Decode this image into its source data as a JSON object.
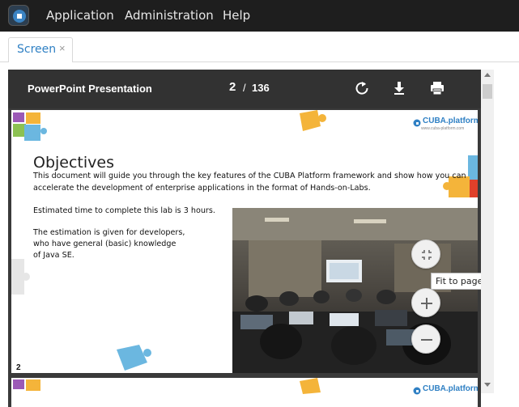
{
  "app": {
    "menu": [
      "Application",
      "Administration",
      "Help"
    ]
  },
  "tabs": [
    {
      "label": "Screen",
      "close": "×"
    }
  ],
  "viewer": {
    "title": "PowerPoint Presentation",
    "current_page": "2",
    "page_separator": "/",
    "total_pages": "136",
    "tools": [
      "rotate-icon",
      "download-icon",
      "print-icon"
    ],
    "zoom_tooltip": "Fit to page"
  },
  "slide": {
    "brand": "CUBA.platform",
    "brand_url": "www.cuba-platform.com",
    "heading": "Objectives",
    "paragraph1_line1": "This document will guide you through the key features of the CUBA Platform framework and show how you can",
    "paragraph1_line2": "accelerate the development of enterprise applications in the format of Hands-on-Labs.",
    "paragraph2": "Estimated time to complete this lab is 3 hours.",
    "paragraph3_line1": "The estimation is given for developers,",
    "paragraph3_line2": "who have general (basic) knowledge",
    "paragraph3_line3": "of Java SE.",
    "page_number": "2"
  },
  "colors": {
    "topbar": "#1e1e1e",
    "accent": "#2f80c4",
    "viewer_toolbar": "#323232",
    "puzzle_orange": "#f4b43a",
    "puzzle_blue": "#6bb7e0",
    "puzzle_green": "#8cc152",
    "puzzle_purple": "#9b59b6",
    "puzzle_red": "#e0402a"
  }
}
